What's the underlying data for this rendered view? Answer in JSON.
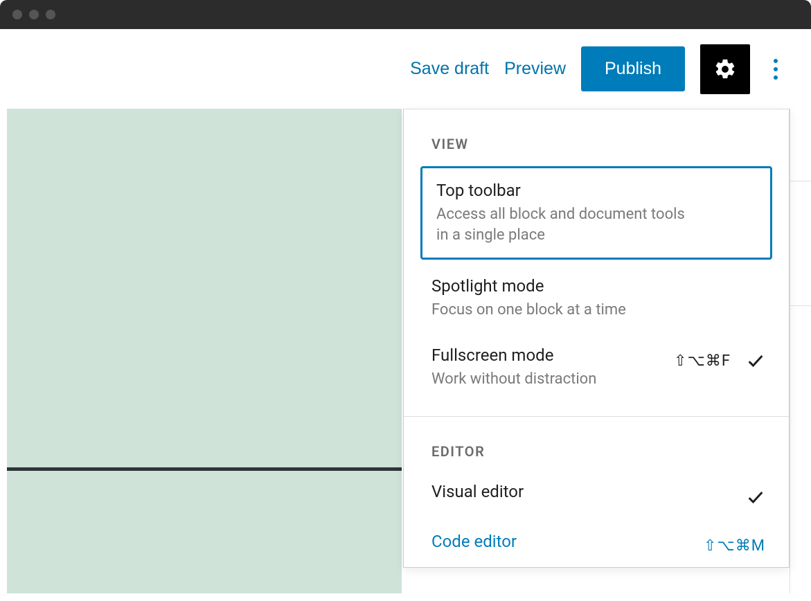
{
  "toolbar": {
    "save_draft": "Save draft",
    "preview": "Preview",
    "publish": "Publish"
  },
  "menu": {
    "view_label": "VIEW",
    "editor_label": "EDITOR",
    "items": {
      "top_toolbar": {
        "title": "Top toolbar",
        "desc": "Access all block and document tools in a single place"
      },
      "spotlight": {
        "title": "Spotlight mode",
        "desc": "Focus on one block at a time"
      },
      "fullscreen": {
        "title": "Fullscreen mode",
        "desc": "Work without distraction",
        "shortcut": "⇧⌥⌘F",
        "checked": true
      },
      "visual": {
        "title": "Visual editor",
        "checked": true
      },
      "code": {
        "title": "Code editor",
        "shortcut": "⇧⌥⌘M"
      }
    }
  }
}
